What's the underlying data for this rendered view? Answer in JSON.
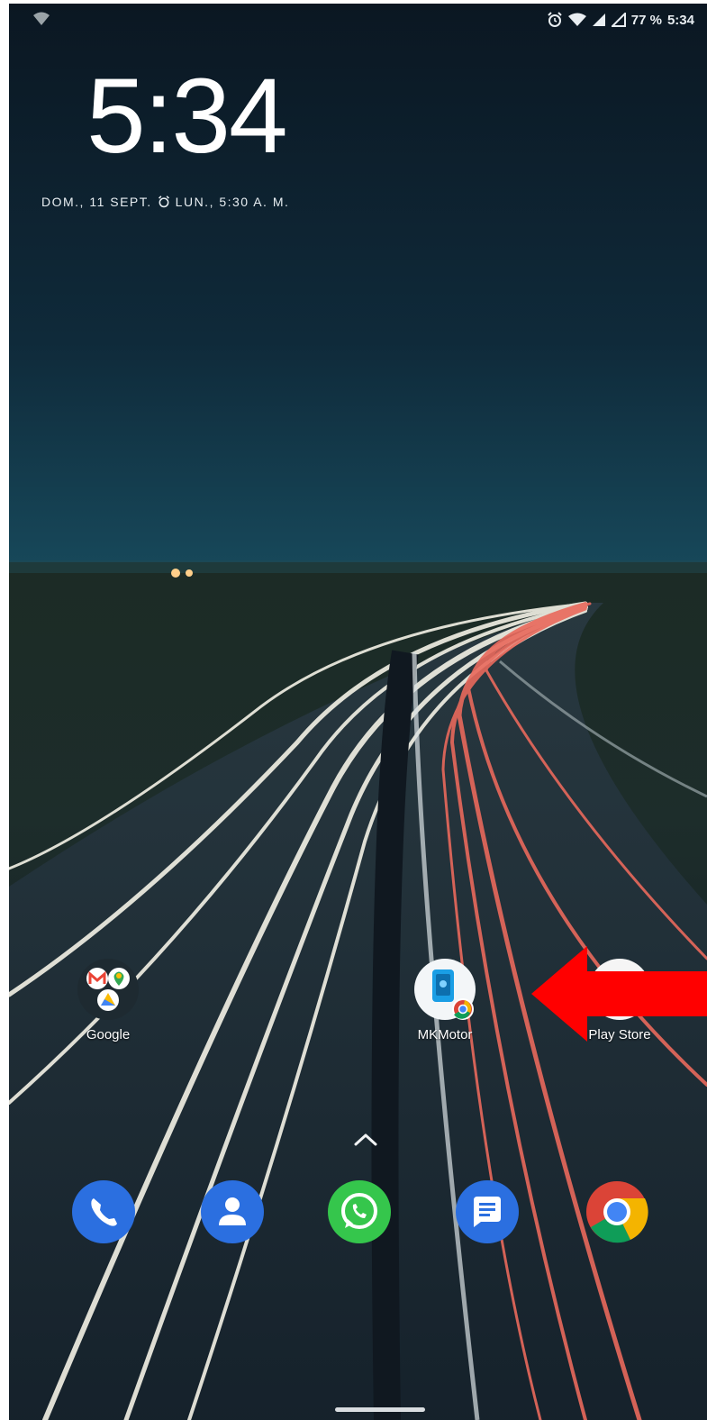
{
  "status_bar": {
    "battery_percent": "77 %",
    "time": "5:34",
    "icons": [
      "alarm-icon",
      "wifi-icon",
      "signal-icon",
      "signal-icon"
    ]
  },
  "lockscreen": {
    "clock": "5:34",
    "date": "DOM., 11 SEPT.",
    "alarm": "LUN., 5:30 A. M."
  },
  "home": {
    "apps": [
      {
        "label": "Google",
        "icon": "google-folder-icon"
      },
      {
        "label": "MKMotor",
        "icon": "mkmotor-icon"
      },
      {
        "label": "Play Store",
        "icon": "play-store-icon"
      }
    ],
    "dock": [
      {
        "name": "phone",
        "icon": "phone-icon",
        "color": "#2b6fe0"
      },
      {
        "name": "contacts",
        "icon": "contacts-icon",
        "color": "#2b6fe0"
      },
      {
        "name": "whatsapp",
        "icon": "whatsapp-icon",
        "color": "#35c64c"
      },
      {
        "name": "messages",
        "icon": "messages-icon",
        "color": "#2b6fe0"
      },
      {
        "name": "chrome",
        "icon": "chrome-icon",
        "color": "#ffffff"
      }
    ]
  },
  "annotation": {
    "arrow_color": "#ff0000",
    "arrow_icon": "red-arrow-icon"
  }
}
